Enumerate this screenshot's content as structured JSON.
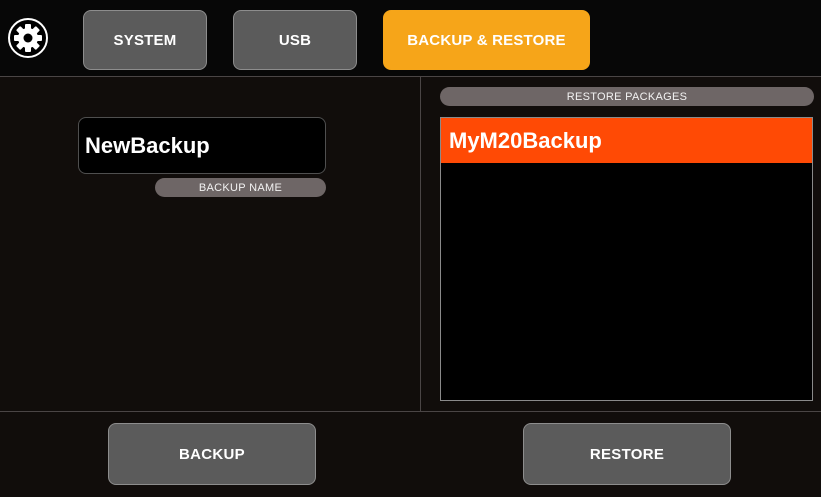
{
  "header": {
    "settings_icon": "gear-icon",
    "tabs": [
      {
        "label": "SYSTEM",
        "active": false
      },
      {
        "label": "USB",
        "active": false
      },
      {
        "label": "BACKUP & RESTORE",
        "active": true
      }
    ]
  },
  "backup": {
    "name_value": "NewBackup",
    "name_label": "BACKUP NAME"
  },
  "restore": {
    "label": "RESTORE PACKAGES",
    "packages": [
      {
        "name": "MyM20Backup",
        "selected": true
      }
    ]
  },
  "footer": {
    "backup_label": "BACKUP",
    "restore_label": "RESTORE"
  },
  "colors": {
    "active_tab": "#f6a519",
    "selected_item": "#ff4a05",
    "button": "#5b5b5b",
    "background": "#110d0b"
  }
}
